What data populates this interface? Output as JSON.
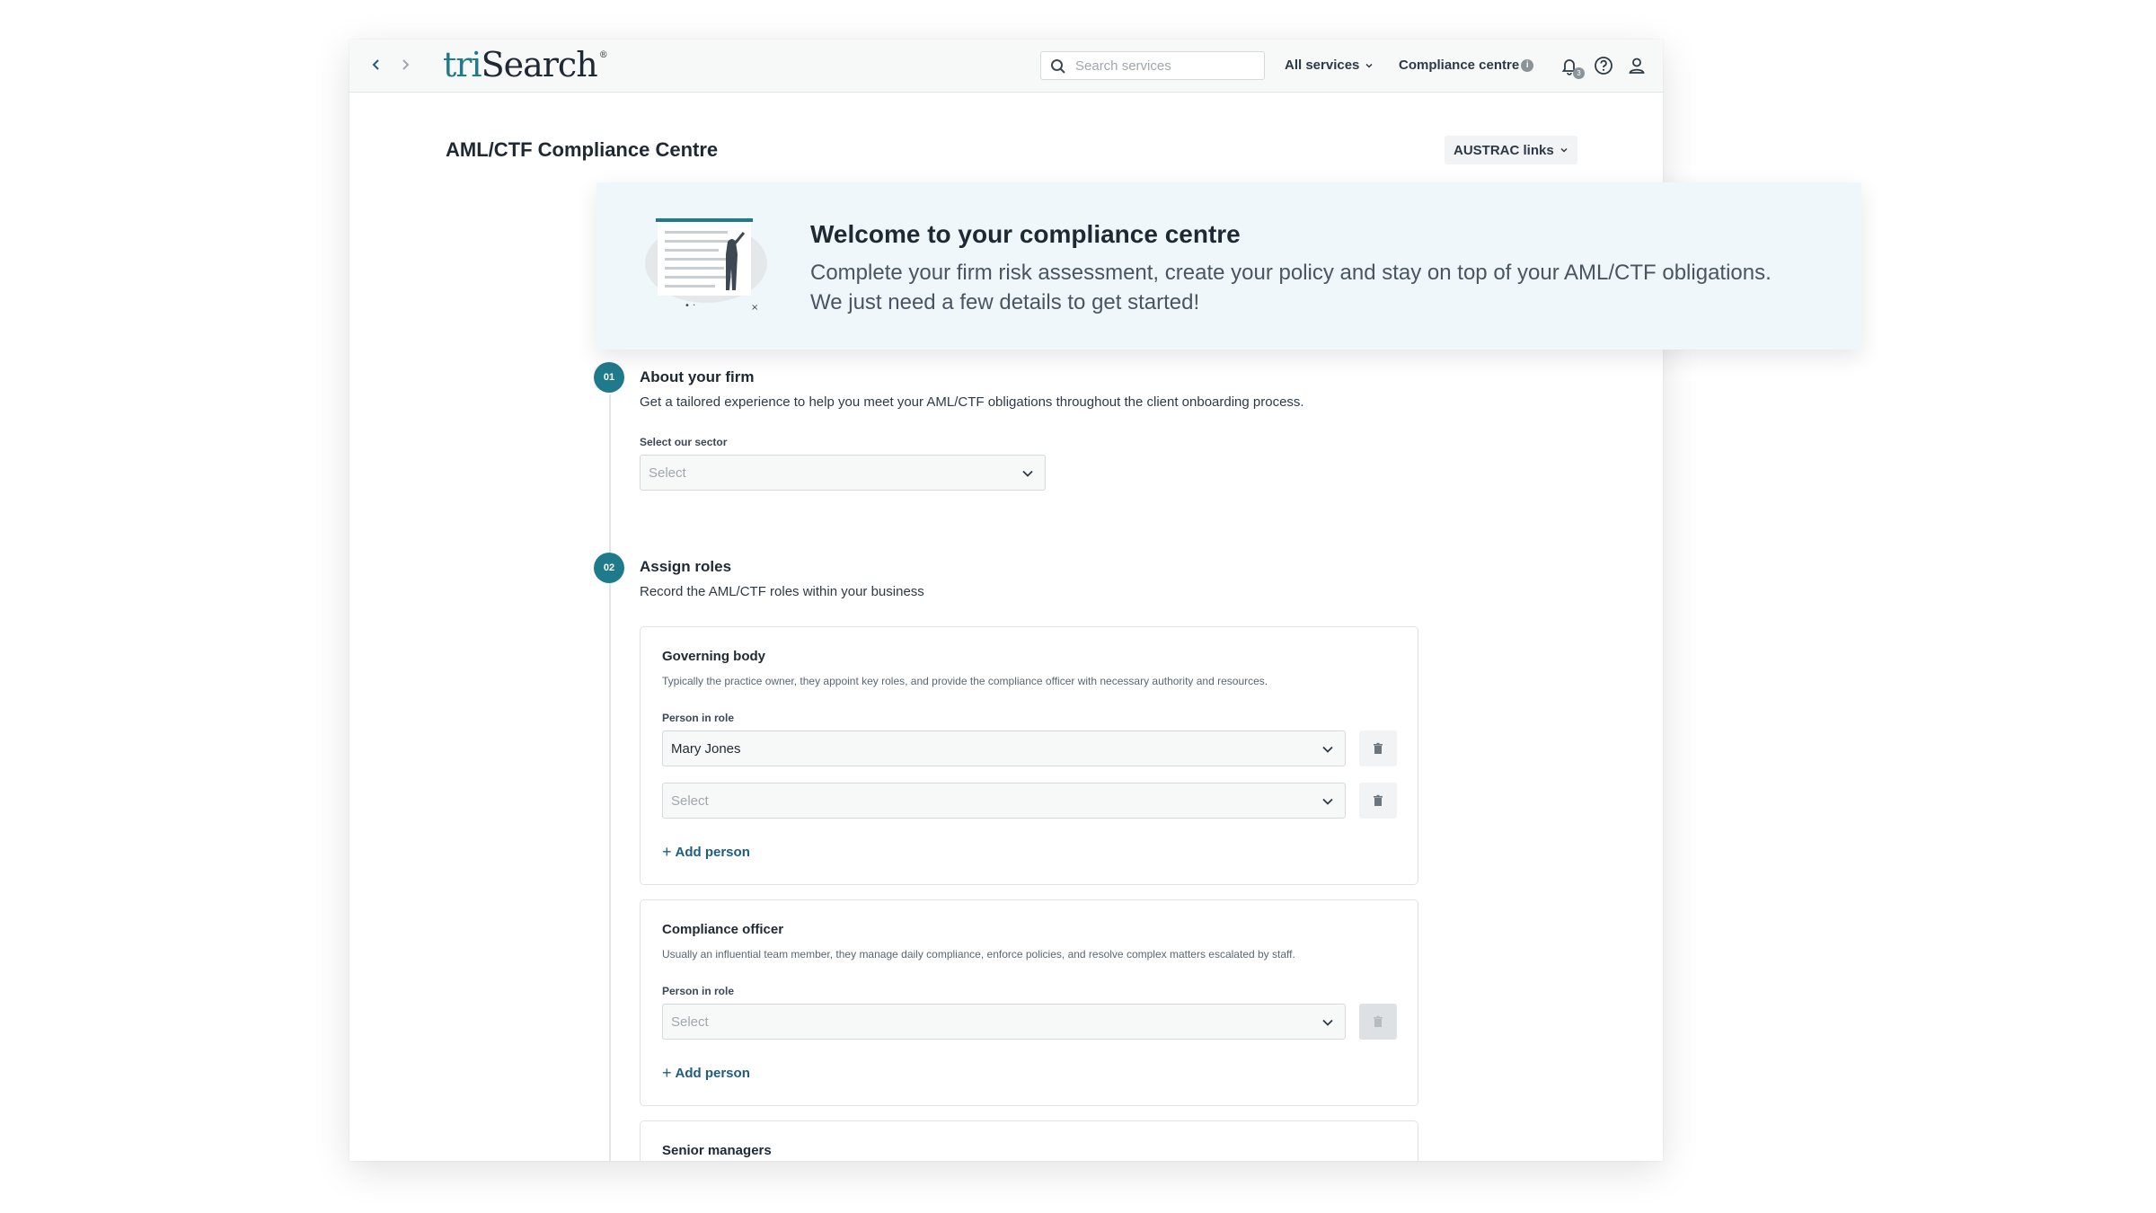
{
  "header": {
    "logo_prefix": "tri",
    "logo_main": "Search",
    "logo_mark": "®",
    "search_placeholder": "Search services",
    "all_services_label": "All services",
    "compliance_centre_label": "Compliance centre",
    "compliance_info_glyph": "i",
    "notification_count": "3"
  },
  "page": {
    "title": "AML/CTF Compliance Centre",
    "austrac_links_label": "AUSTRAC links"
  },
  "welcome": {
    "title": "Welcome to your compliance centre",
    "line1": "Complete your firm risk assessment, create your policy and stay on top of your AML/CTF obligations.",
    "line2": "We just need a few details to get started!"
  },
  "step1": {
    "number": "01",
    "title": "About your firm",
    "description": "Get a tailored experience to help you meet your AML/CTF obligations throughout the client onboarding process.",
    "sector_label": "Select our sector",
    "sector_placeholder": "Select"
  },
  "step2": {
    "number": "02",
    "title": "Assign roles",
    "description": "Record the AML/CTF roles within your business",
    "roles": [
      {
        "title": "Governing body",
        "description": "Typically the practice owner, they appoint key roles, and provide the compliance officer with necessary authority and resources.",
        "person_label": "Person in role",
        "person_value": "Mary Jones",
        "second_placeholder": "Select",
        "add_label": "Add person"
      },
      {
        "title": "Compliance officer",
        "description": "Usually an influential team member, they manage daily compliance, enforce policies, and resolve complex matters escalated by staff.",
        "person_label": "Person in role",
        "person_placeholder": "Select",
        "add_label": "Add person"
      },
      {
        "title": "Senior managers"
      }
    ]
  },
  "colors": {
    "accent": "#1f7a8c",
    "link": "#1f5d80",
    "welcome_bg": "#eff7fa"
  }
}
